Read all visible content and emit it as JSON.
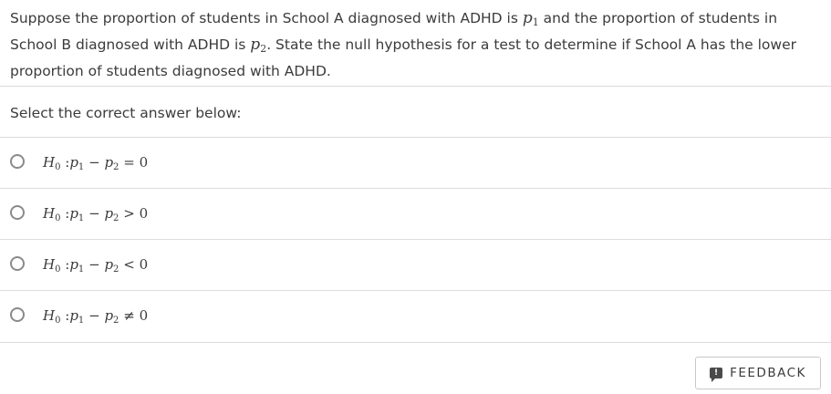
{
  "question": {
    "part1": "Suppose the proportion of students in School A diagnosed with ADHD is ",
    "var1": "p",
    "var1_sub": "1",
    "part2": " and the proportion of students in School B diagnosed with ADHD is ",
    "var2": "p",
    "var2_sub": "2",
    "part3": ". State the null hypothesis for a test to determine if School A has the lower proportion of students diagnosed with ADHD."
  },
  "prompt": "Select the correct answer below:",
  "options": [
    {
      "h": "H",
      "h_sub": "0",
      "rel": ":",
      "a": "p",
      "a_sub": "1",
      "minus": "−",
      "b": "p",
      "b_sub": "2",
      "op": "=",
      "rhs": "0"
    },
    {
      "h": "H",
      "h_sub": "0",
      "rel": ":",
      "a": "p",
      "a_sub": "1",
      "minus": "−",
      "b": "p",
      "b_sub": "2",
      "op": ">",
      "rhs": "0"
    },
    {
      "h": "H",
      "h_sub": "0",
      "rel": ":",
      "a": "p",
      "a_sub": "1",
      "minus": "−",
      "b": "p",
      "b_sub": "2",
      "op": "<",
      "rhs": "0"
    },
    {
      "h": "H",
      "h_sub": "0",
      "rel": ":",
      "a": "p",
      "a_sub": "1",
      "minus": "−",
      "b": "p",
      "b_sub": "2",
      "op": "≠",
      "rhs": "0"
    }
  ],
  "feedback": {
    "icon": "feedback-icon",
    "icon_glyph": "!",
    "label": "FEEDBACK"
  },
  "colors": {
    "text": "#3b3b3b",
    "divider": "#dcdcdc",
    "radio_border": "#8a8a8a"
  }
}
